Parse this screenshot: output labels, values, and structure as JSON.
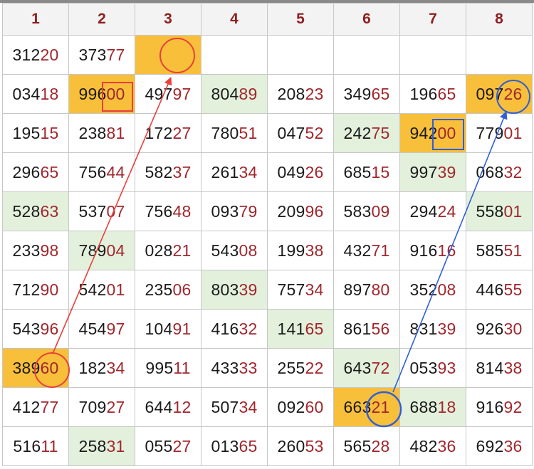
{
  "columns": [
    "1",
    "2",
    "3",
    "4",
    "5",
    "6",
    "7",
    "8"
  ],
  "rows": [
    [
      "31220",
      "37377",
      "",
      "",
      "",
      "",
      "",
      ""
    ],
    [
      "03418",
      "99600",
      "49797",
      "80489",
      "20823",
      "34965",
      "19665",
      "09726"
    ],
    [
      "19515",
      "23881",
      "17227",
      "78051",
      "04752",
      "24275",
      "94200",
      "77901"
    ],
    [
      "29665",
      "75644",
      "58237",
      "26134",
      "04926",
      "68515",
      "99739",
      "06832"
    ],
    [
      "52863",
      "53707",
      "75648",
      "09379",
      "20996",
      "58309",
      "29424",
      "55801"
    ],
    [
      "23398",
      "78904",
      "02821",
      "54308",
      "19938",
      "43271",
      "91616",
      "58551"
    ],
    [
      "71290",
      "54201",
      "23506",
      "80339",
      "75734",
      "89780",
      "35208",
      "44655"
    ],
    [
      "54396",
      "45497",
      "10491",
      "41632",
      "14165",
      "86156",
      "83139",
      "92630"
    ],
    [
      "38960",
      "18234",
      "99511",
      "43333",
      "25522",
      "64372",
      "05393",
      "81438"
    ],
    [
      "41277",
      "70927",
      "64412",
      "50734",
      "09260",
      "66321",
      "68818",
      "91692"
    ],
    [
      "51611",
      "25831",
      "05527",
      "01365",
      "26053",
      "56528",
      "48236",
      "69236"
    ]
  ],
  "highlights": {
    "green": [
      [
        1,
        3
      ],
      [
        2,
        5
      ],
      [
        3,
        6
      ],
      [
        4,
        0
      ],
      [
        4,
        7
      ],
      [
        5,
        1
      ],
      [
        6,
        3
      ],
      [
        7,
        4
      ],
      [
        8,
        5
      ],
      [
        9,
        6
      ],
      [
        10,
        1
      ]
    ],
    "gold": [
      [
        0,
        2
      ],
      [
        1,
        1
      ],
      [
        1,
        7
      ],
      [
        2,
        6
      ],
      [
        8,
        0
      ],
      [
        9,
        5
      ]
    ]
  },
  "colors": {
    "header_text": "#8e1f1f",
    "number_tail": "#a0272d",
    "number_head": "#1a1a1a",
    "green_cell": "#e3f0dc",
    "gold_cell": "#f8bf3b",
    "red_marker": "#e8413a",
    "blue_marker": "#2f5fd8"
  }
}
